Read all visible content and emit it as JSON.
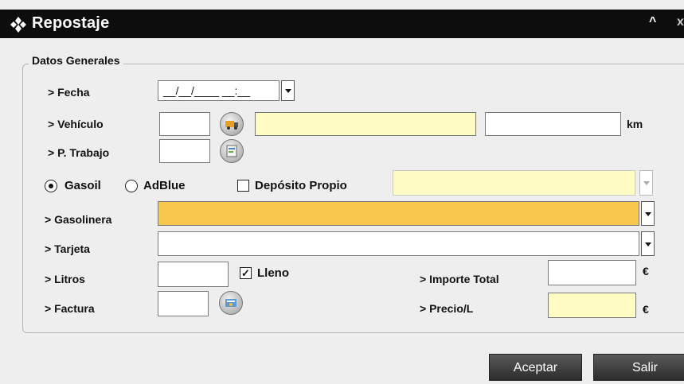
{
  "window": {
    "title": "Repostaje",
    "collapse_glyph": "^",
    "close_glyph": "x"
  },
  "general": {
    "legend": "Datos Generales",
    "fecha_label": "> Fecha",
    "fecha_value": "__/__/____ __:__",
    "vehiculo_label": "> Vehículo",
    "km_unit": "km",
    "p_trabajo_label": "> P. Trabajo",
    "gasoil_label": "Gasoil",
    "adblue_label": "AdBlue",
    "deposito_label": "Depósito Propio",
    "gasolinera_label": "> Gasolinera",
    "tarjeta_label": "> Tarjeta",
    "litros_label": "> Litros",
    "lleno_label": "Lleno",
    "lleno_checked": "✓",
    "importe_label": "> Importe Total",
    "importe_unit": "€",
    "factura_label": "> Factura",
    "precio_label": "> Precio/L",
    "precio_unit": "€"
  },
  "buttons": {
    "accept": "Aceptar",
    "exit": "Salir"
  },
  "colors": {
    "titlebar": "#0d0d0d",
    "panel": "#eeeeee",
    "highlight_yellow": "#fffcc4",
    "highlight_orange": "#f8c84e"
  }
}
